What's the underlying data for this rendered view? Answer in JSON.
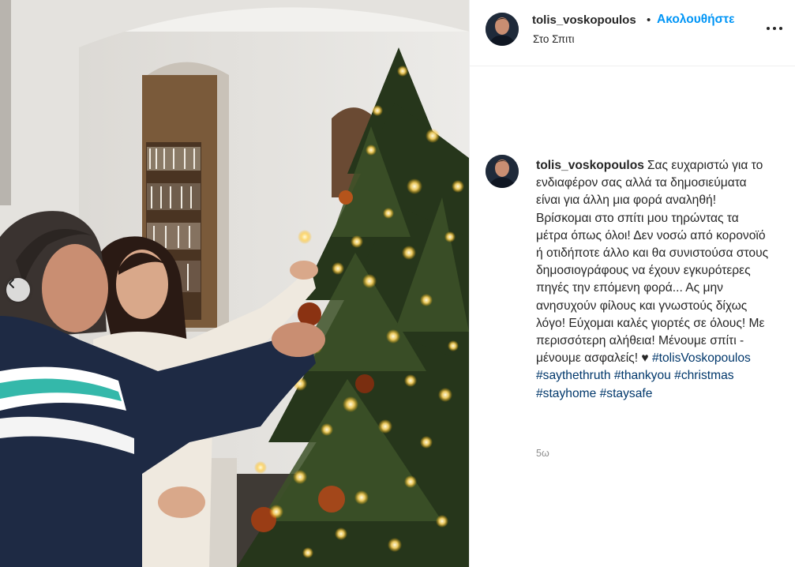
{
  "post": {
    "username": "tolis_voskopoulos",
    "separator": "•",
    "follow_label": "Ακολουθήστε",
    "location": "Στο Σπιτι",
    "more_icon": "more-options-icon",
    "photo_alt": "post-photo",
    "prev_icon": "chevron-left-icon"
  },
  "caption": {
    "username": "tolis_voskopoulos",
    "text": "Σας ευχαριστώ για το ενδιαφέρον σας αλλά τα δημοσιεύματα είναι για άλλη μια φορά αναληθή! Βρίσκομαι στο σπίτι μου τηρώντας τα μέτρα όπως όλοι! Δεν νοσώ από κορονοϊό ή οτιδήποτε άλλο και θα συνιστούσα στους δημοσιογράφους να έχουν εγκυρότερες πηγές την επόμενη φορά... Ας μην ανησυχούν φίλους και γνωστούς δίχως λόγο! Εύχομαι καλές γιορτές σε όλους! Με περισσότερη αλήθεια! Μένουμε σπίτι - μένουμε ασφαλείς!",
    "emoji": "♥",
    "hashtags": [
      "#tolisVoskopoulos",
      "#saythethruth",
      "#thankyou",
      "#christmas",
      "#stayhome",
      "#staysafe"
    ],
    "time_ago": "5ω"
  },
  "colors": {
    "follow_blue": "#0095f6",
    "hashtag_blue": "#00376b",
    "meta_gray": "#8e8e8e"
  }
}
